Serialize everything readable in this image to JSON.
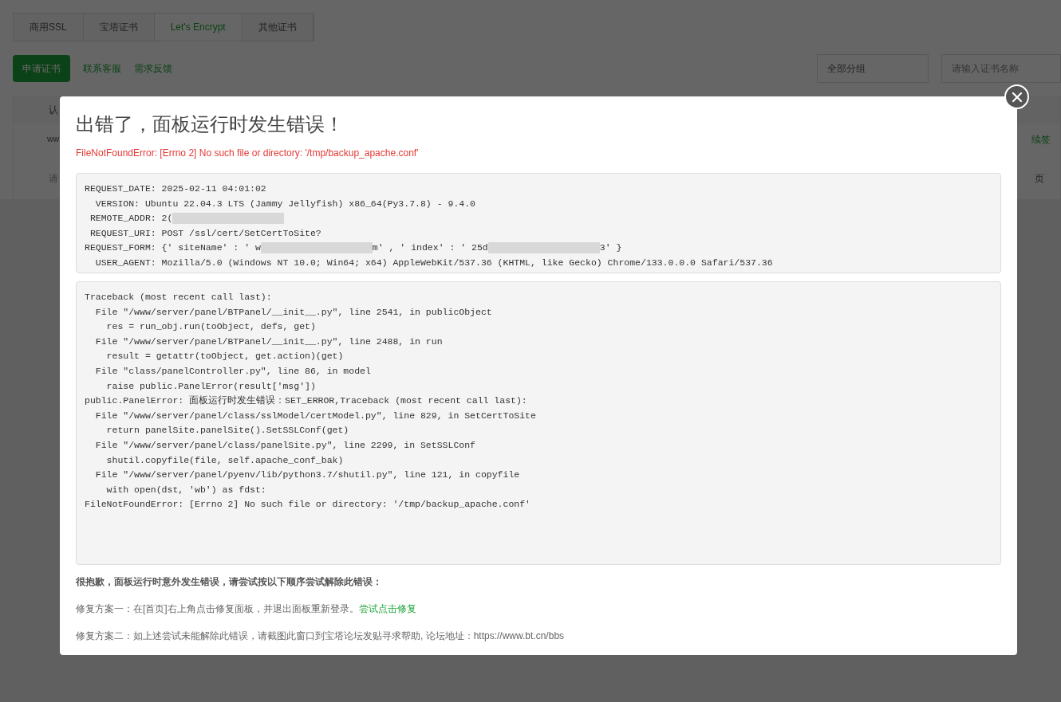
{
  "background": {
    "tabs": [
      {
        "label": "商用SSL",
        "selected": false
      },
      {
        "label": "宝塔证书",
        "selected": false
      },
      {
        "label": "Let's Encrypt",
        "selected": true
      },
      {
        "label": "其他证书",
        "selected": false
      }
    ],
    "apply_button": "申请证书",
    "contact_link": "联系客服",
    "feedback_link": "需求反馈",
    "group_select": "全部分组",
    "search": {
      "placeholder": "请输入证书名称"
    },
    "table_header": "认",
    "row_text": "ww",
    "renew_link": "续签",
    "footer_field": "请",
    "pager_text": "页"
  },
  "dialog": {
    "title": "出错了，面板运行时发生错误！",
    "error": "FileNotFoundError: [Errno 2] No such file or directory: '/tmp/backup_apache.conf'",
    "request_info": [
      [
        {
          "kind": "text",
          "text": "REQUEST_DATE: 2025-02-11 04:01:02"
        }
      ],
      [
        {
          "kind": "text",
          "text": "  VERSION: Ubuntu 22.04.3 LTS (Jammy Jellyfish) x86_64(Py3.7.8) - 9.4.0"
        }
      ],
      [
        {
          "kind": "text",
          "text": " REMOTE_ADDR: 2("
        },
        {
          "kind": "redacted"
        }
      ],
      [
        {
          "kind": "text",
          "text": " REQUEST_URI: POST /ssl/cert/SetCertToSite?"
        }
      ],
      [
        {
          "kind": "text",
          "text": "REQUEST_FORM: {' siteName' : ' w"
        },
        {
          "kind": "redacted"
        },
        {
          "kind": "text",
          "text": "m' , ' index' : ' 25d"
        },
        {
          "kind": "redacted"
        },
        {
          "kind": "text",
          "text": "3' }"
        }
      ],
      [
        {
          "kind": "text",
          "text": "  USER_AGENT: Mozilla/5.0 (Windows NT 10.0; Win64; x64) AppleWebKit/537.36 (KHTML, like Gecko) Chrome/133.0.0.0 Safari/537.36"
        }
      ]
    ],
    "traceback": [
      "Traceback (most recent call last):",
      "  File \"/www/server/panel/BTPanel/__init__.py\", line 2541, in publicObject",
      "    res = run_obj.run(toObject, defs, get)",
      "  File \"/www/server/panel/BTPanel/__init__.py\", line 2488, in run",
      "    result = getattr(toObject, get.action)(get)",
      "  File \"class/panelController.py\", line 86, in model",
      "    raise public.PanelError(result['msg'])",
      "public.PanelError: 面板运行时发生错误：SET_ERROR,Traceback (most recent call last):",
      "  File \"/www/server/panel/class/sslModel/certModel.py\", line 829, in SetCertToSite",
      "    return panelSite.panelSite().SetSSLConf(get)",
      "  File \"/www/server/panel/class/panelSite.py\", line 2299, in SetSSLConf",
      "    shutil.copyfile(file, self.apache_conf_bak)",
      "  File \"/www/server/panel/pyenv/lib/python3.7/shutil.py\", line 121, in copyfile",
      "    with open(dst, 'wb') as fdst:",
      "FileNotFoundError: [Errno 2] No such file or directory: '/tmp/backup_apache.conf'"
    ],
    "apology": "很抱歉，面板运行时意外发生错误，请尝试按以下顺序尝试解除此错误：",
    "fix_one": "修复方案一：在[首页]右上角点击修复面板，并退出面板重新登录。",
    "fix_one_link": "尝试点击修复",
    "fix_two": "修复方案二：如上述尝试未能解除此错误，请截图此窗口到宝塔论坛发贴寻求帮助, 论坛地址：https://www.bt.cn/bbs"
  }
}
